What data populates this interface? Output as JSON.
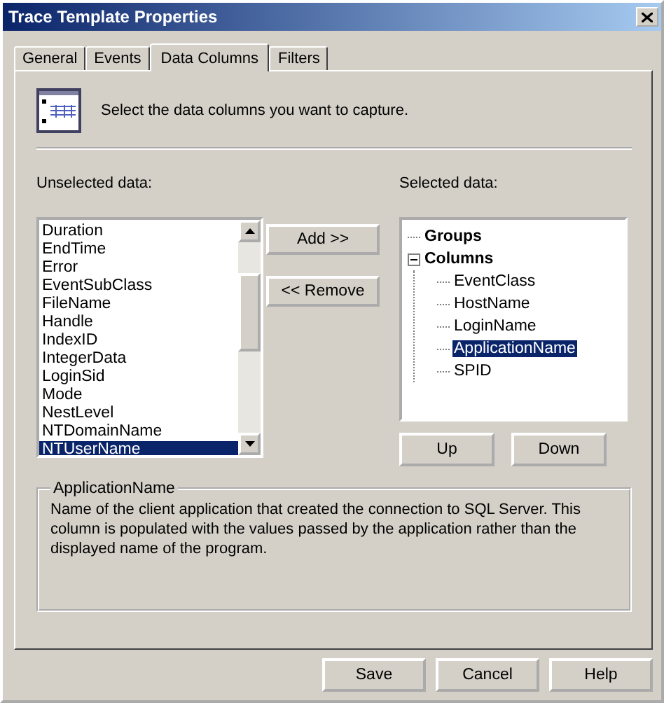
{
  "window": {
    "title": "Trace Template Properties"
  },
  "tabs": [
    {
      "label": "General",
      "selected": false
    },
    {
      "label": "Events",
      "selected": false
    },
    {
      "label": "Data Columns",
      "selected": true
    },
    {
      "label": "Filters",
      "selected": false
    }
  ],
  "instruction": "Select the data columns you want to capture.",
  "unselected": {
    "label": "Unselected data:",
    "items": [
      {
        "label": "Duration",
        "selected": false
      },
      {
        "label": "EndTime",
        "selected": false
      },
      {
        "label": "Error",
        "selected": false
      },
      {
        "label": "EventSubClass",
        "selected": false
      },
      {
        "label": "FileName",
        "selected": false
      },
      {
        "label": "Handle",
        "selected": false
      },
      {
        "label": "IndexID",
        "selected": false
      },
      {
        "label": "IntegerData",
        "selected": false
      },
      {
        "label": "LoginSid",
        "selected": false
      },
      {
        "label": "Mode",
        "selected": false
      },
      {
        "label": "NestLevel",
        "selected": false
      },
      {
        "label": "NTDomainName",
        "selected": false
      },
      {
        "label": "NTUserName",
        "selected": true
      }
    ]
  },
  "move_buttons": [
    "Add >>",
    "<< Remove"
  ],
  "selected_data": {
    "label": "Selected data:",
    "tree": [
      {
        "label": "Groups",
        "selected": false
      },
      {
        "label": "Columns",
        "selected": false,
        "expanded": true,
        "children": [
          {
            "label": "EventClass",
            "selected": false
          },
          {
            "label": "HostName",
            "selected": false
          },
          {
            "label": "LoginName",
            "selected": false
          },
          {
            "label": "ApplicationName",
            "selected": true
          },
          {
            "label": "SPID",
            "selected": false
          }
        ]
      }
    ]
  },
  "order_buttons": [
    "Up",
    "Down"
  ],
  "description": {
    "title": "ApplicationName",
    "text": "Name of the client application that created the connection to SQL Server. This column is populated with the values passed by the application rather than the displayed name of the program."
  },
  "buttons": [
    "Save",
    "Cancel",
    "Help"
  ]
}
